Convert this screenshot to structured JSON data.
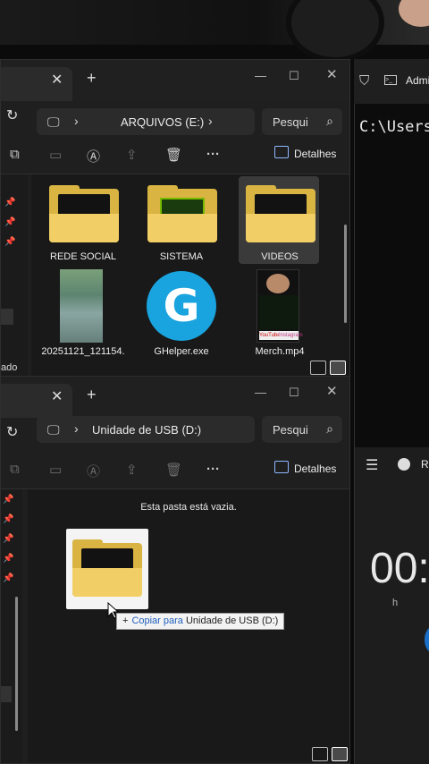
{
  "explorer_top": {
    "address": "ARQUIVOS (E:)",
    "search_placeholder": "Pesqui",
    "details_label": "Detalhes",
    "left_fragment": "ado",
    "items": [
      {
        "label": "REDE SOCIAL",
        "type": "folder",
        "icon": "folder-icon"
      },
      {
        "label": "SISTEMA",
        "type": "folder",
        "icon": "nvidia-folder-icon"
      },
      {
        "label": "VIDEOS",
        "type": "folder",
        "icon": "folder-icon",
        "selected": true
      },
      {
        "label": "20251121_121154.",
        "type": "video",
        "icon": "video-thumbnail"
      },
      {
        "label": "GHelper.exe",
        "type": "exe",
        "icon": "ghelper-icon"
      },
      {
        "label": "Merch.mp4",
        "type": "video",
        "icon": "video-thumbnail"
      }
    ]
  },
  "explorer_bottom": {
    "address": "Unidade de USB (D:)",
    "search_placeholder": "Pesqui",
    "details_label": "Detalhes",
    "empty_message": "Esta pasta está vazia."
  },
  "tooltip": {
    "plus": "+",
    "action": "Copiar para",
    "destination": "Unidade de USB (D:)"
  },
  "terminal": {
    "tab_label": "Admi",
    "prompt": "C:\\Users"
  },
  "clock_app": {
    "tab_label": "Re",
    "time_display": "00:",
    "unit_label": "h"
  },
  "merch_thumb": {
    "labels": [
      "YouTube",
      "Instagram"
    ]
  },
  "colors": {
    "accent_blue": "#8fb9ff",
    "folder_yellow": "#f2cf66",
    "ghelper_blue": "#19a3df",
    "tooltip_action": "#1f5fbf"
  }
}
